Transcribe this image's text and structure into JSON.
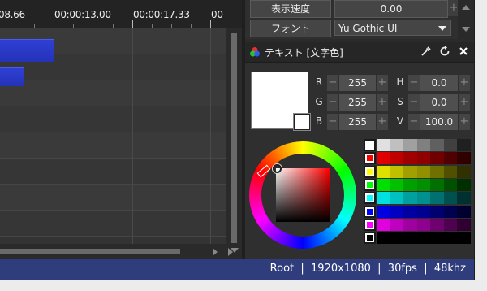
{
  "timeline": {
    "ruler_times": [
      "08.66",
      "00:00:13.00",
      "00:00:17.33",
      "00"
    ],
    "clip_color": "#2a39c8"
  },
  "properties": {
    "rows": [
      {
        "label": "表示速度",
        "value": "0.00"
      },
      {
        "label": "フォント",
        "value": "Yu Gothic UI"
      }
    ]
  },
  "color_panel": {
    "title": "テキスト [文字色]",
    "icons": [
      "color-wheel-icon",
      "eyedropper-icon",
      "refresh-icon",
      "close-icon"
    ],
    "current_color": "#ffffff",
    "rgb": [
      {
        "label": "R",
        "value": "255"
      },
      {
        "label": "G",
        "value": "255"
      },
      {
        "label": "B",
        "value": "255"
      }
    ],
    "hsv": [
      {
        "label": "H",
        "value": "0.0"
      },
      {
        "label": "S",
        "value": "0.0"
      },
      {
        "label": "V",
        "value": "100.0"
      }
    ],
    "palette_keys": [
      "#ffffff",
      "#ff0000",
      "#ffff00",
      "#00ff00",
      "#00ffff",
      "#0000ff",
      "#ff00ff",
      "#000000"
    ]
  },
  "status_bar": {
    "text": "Root  |  1920x1080  |  30fps  |  48khz",
    "color": "#2f3d7c"
  }
}
